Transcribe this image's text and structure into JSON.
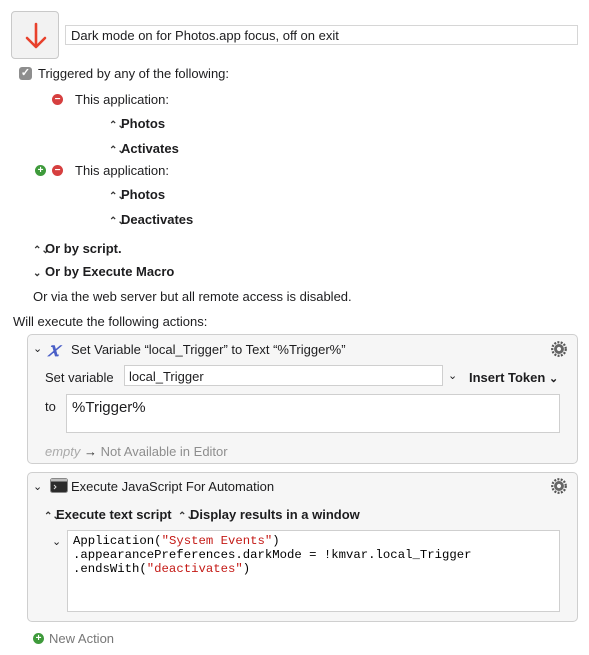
{
  "macro": {
    "name": "Dark mode on for Photos.app focus, off on exit"
  },
  "trigger": {
    "checkbox_label": "Triggered by any of the following:",
    "app_triggers": [
      {
        "label": "This application:",
        "app": "Photos",
        "event": "Activates"
      },
      {
        "label": "This application:",
        "app": "Photos",
        "event": "Deactivates"
      }
    ],
    "or_by_script": "Or by script.",
    "or_by_execute_macro": "Or by Execute Macro",
    "web_server_note": "Or via the web server but all remote access is disabled."
  },
  "actions_heading": "Will execute the following actions:",
  "set_variable_action": {
    "title": "Set Variable “local_Trigger” to Text “%Trigger%”",
    "set_variable_label": "Set variable",
    "variable_value": "local_Trigger",
    "insert_token_label": "Insert Token",
    "to_label": "to",
    "to_value": "%Trigger%",
    "empty_label": "empty",
    "arrow": "→",
    "not_available": "Not Available in Editor"
  },
  "jxa_action": {
    "title": "Execute JavaScript For Automation",
    "execute_option": "Execute text script",
    "display_option": "Display results in a window",
    "code": {
      "l1_a": "Application(",
      "l1_b": "\"System Events\"",
      "l1_c": ")",
      "l2": ".appearancePreferences.darkMode = !kmvar.local_Trigger",
      "l3_a": ".endsWith(",
      "l3_b": "\"deactivates\"",
      "l3_c": ")"
    }
  },
  "new_action_label": "New Action",
  "colors": {
    "accent_red": "#d63f3f",
    "accent_green": "#3e9a3b",
    "string_red": "#c41a16"
  }
}
